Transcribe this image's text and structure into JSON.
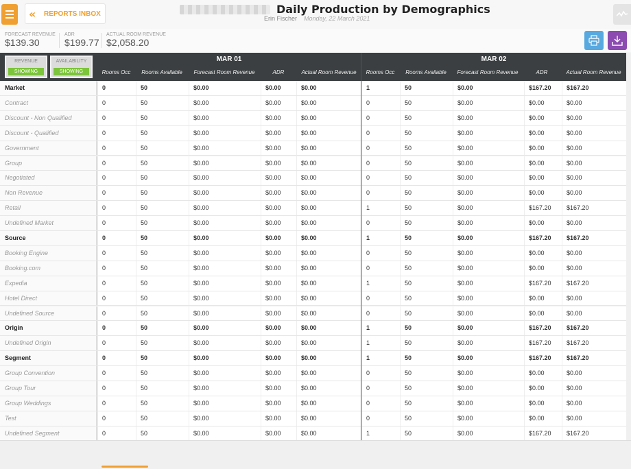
{
  "header": {
    "back_label": "REPORTS INBOX",
    "title": "Daily Production by Demographics",
    "user": "Erin Fischer",
    "date": "Monday, 22 March 2021"
  },
  "stats": [
    {
      "label": "FORECAST REVENUE",
      "value": "$139.30"
    },
    {
      "label": "ADR",
      "value": "$199.77"
    },
    {
      "label": "ACTUAL ROOM REVENUE",
      "value": "$2,058.20"
    }
  ],
  "toggles": [
    {
      "label": "REVENUE",
      "state": "SHOWING"
    },
    {
      "label": "AVAILABILITY",
      "state": "SHOWING"
    }
  ],
  "columns": [
    "Rooms Occ",
    "Rooms Available",
    "Forecast Room Revenue",
    "ADR",
    "Actual Room Revenue"
  ],
  "dates": [
    "MAR 01",
    "MAR 02"
  ],
  "rows": [
    {
      "label": "Market",
      "bold": true,
      "d1": [
        "0",
        "50",
        "$0.00",
        "$0.00",
        "$0.00"
      ],
      "d2": [
        "1",
        "50",
        "$0.00",
        "$167.20",
        "$167.20"
      ]
    },
    {
      "label": "Contract",
      "bold": false,
      "d1": [
        "0",
        "50",
        "$0.00",
        "$0.00",
        "$0.00"
      ],
      "d2": [
        "0",
        "50",
        "$0.00",
        "$0.00",
        "$0.00"
      ]
    },
    {
      "label": "Discount - Non Qualified",
      "bold": false,
      "d1": [
        "0",
        "50",
        "$0.00",
        "$0.00",
        "$0.00"
      ],
      "d2": [
        "0",
        "50",
        "$0.00",
        "$0.00",
        "$0.00"
      ]
    },
    {
      "label": "Discount - Qualified",
      "bold": false,
      "d1": [
        "0",
        "50",
        "$0.00",
        "$0.00",
        "$0.00"
      ],
      "d2": [
        "0",
        "50",
        "$0.00",
        "$0.00",
        "$0.00"
      ]
    },
    {
      "label": "Government",
      "bold": false,
      "d1": [
        "0",
        "50",
        "$0.00",
        "$0.00",
        "$0.00"
      ],
      "d2": [
        "0",
        "50",
        "$0.00",
        "$0.00",
        "$0.00"
      ]
    },
    {
      "label": "Group",
      "bold": false,
      "d1": [
        "0",
        "50",
        "$0.00",
        "$0.00",
        "$0.00"
      ],
      "d2": [
        "0",
        "50",
        "$0.00",
        "$0.00",
        "$0.00"
      ]
    },
    {
      "label": "Negotiated",
      "bold": false,
      "d1": [
        "0",
        "50",
        "$0.00",
        "$0.00",
        "$0.00"
      ],
      "d2": [
        "0",
        "50",
        "$0.00",
        "$0.00",
        "$0.00"
      ]
    },
    {
      "label": "Non Revenue",
      "bold": false,
      "d1": [
        "0",
        "50",
        "$0.00",
        "$0.00",
        "$0.00"
      ],
      "d2": [
        "0",
        "50",
        "$0.00",
        "$0.00",
        "$0.00"
      ]
    },
    {
      "label": "Retail",
      "bold": false,
      "d1": [
        "0",
        "50",
        "$0.00",
        "$0.00",
        "$0.00"
      ],
      "d2": [
        "1",
        "50",
        "$0.00",
        "$167.20",
        "$167.20"
      ]
    },
    {
      "label": "Undefined Market",
      "bold": false,
      "d1": [
        "0",
        "50",
        "$0.00",
        "$0.00",
        "$0.00"
      ],
      "d2": [
        "0",
        "50",
        "$0.00",
        "$0.00",
        "$0.00"
      ]
    },
    {
      "label": "Source",
      "bold": true,
      "d1": [
        "0",
        "50",
        "$0.00",
        "$0.00",
        "$0.00"
      ],
      "d2": [
        "1",
        "50",
        "$0.00",
        "$167.20",
        "$167.20"
      ]
    },
    {
      "label": "Booking Engine",
      "bold": false,
      "d1": [
        "0",
        "50",
        "$0.00",
        "$0.00",
        "$0.00"
      ],
      "d2": [
        "0",
        "50",
        "$0.00",
        "$0.00",
        "$0.00"
      ]
    },
    {
      "label": "Booking.com",
      "bold": false,
      "d1": [
        "0",
        "50",
        "$0.00",
        "$0.00",
        "$0.00"
      ],
      "d2": [
        "0",
        "50",
        "$0.00",
        "$0.00",
        "$0.00"
      ]
    },
    {
      "label": "Expedia",
      "bold": false,
      "d1": [
        "0",
        "50",
        "$0.00",
        "$0.00",
        "$0.00"
      ],
      "d2": [
        "1",
        "50",
        "$0.00",
        "$167.20",
        "$167.20"
      ]
    },
    {
      "label": "Hotel Direct",
      "bold": false,
      "d1": [
        "0",
        "50",
        "$0.00",
        "$0.00",
        "$0.00"
      ],
      "d2": [
        "0",
        "50",
        "$0.00",
        "$0.00",
        "$0.00"
      ]
    },
    {
      "label": "Undefined Source",
      "bold": false,
      "d1": [
        "0",
        "50",
        "$0.00",
        "$0.00",
        "$0.00"
      ],
      "d2": [
        "0",
        "50",
        "$0.00",
        "$0.00",
        "$0.00"
      ]
    },
    {
      "label": "Origin",
      "bold": true,
      "d1": [
        "0",
        "50",
        "$0.00",
        "$0.00",
        "$0.00"
      ],
      "d2": [
        "1",
        "50",
        "$0.00",
        "$167.20",
        "$167.20"
      ]
    },
    {
      "label": "Undefined Origin",
      "bold": false,
      "d1": [
        "0",
        "50",
        "$0.00",
        "$0.00",
        "$0.00"
      ],
      "d2": [
        "1",
        "50",
        "$0.00",
        "$167.20",
        "$167.20"
      ]
    },
    {
      "label": "Segment",
      "bold": true,
      "d1": [
        "0",
        "50",
        "$0.00",
        "$0.00",
        "$0.00"
      ],
      "d2": [
        "1",
        "50",
        "$0.00",
        "$167.20",
        "$167.20"
      ]
    },
    {
      "label": "Group Convention",
      "bold": false,
      "d1": [
        "0",
        "50",
        "$0.00",
        "$0.00",
        "$0.00"
      ],
      "d2": [
        "0",
        "50",
        "$0.00",
        "$0.00",
        "$0.00"
      ]
    },
    {
      "label": "Group Tour",
      "bold": false,
      "d1": [
        "0",
        "50",
        "$0.00",
        "$0.00",
        "$0.00"
      ],
      "d2": [
        "0",
        "50",
        "$0.00",
        "$0.00",
        "$0.00"
      ]
    },
    {
      "label": "Group Weddings",
      "bold": false,
      "d1": [
        "0",
        "50",
        "$0.00",
        "$0.00",
        "$0.00"
      ],
      "d2": [
        "0",
        "50",
        "$0.00",
        "$0.00",
        "$0.00"
      ]
    },
    {
      "label": "Test",
      "bold": false,
      "d1": [
        "0",
        "50",
        "$0.00",
        "$0.00",
        "$0.00"
      ],
      "d2": [
        "0",
        "50",
        "$0.00",
        "$0.00",
        "$0.00"
      ]
    },
    {
      "label": "Undefined Segment",
      "bold": false,
      "d1": [
        "0",
        "50",
        "$0.00",
        "$0.00",
        "$0.00"
      ],
      "d2": [
        "1",
        "50",
        "$0.00",
        "$167.20",
        "$167.20"
      ]
    }
  ],
  "colors": {
    "accent": "#f0a030",
    "header_bg": "#3b3f41",
    "showing": "#7cc43b",
    "print": "#58a9df",
    "download": "#8b4bb0"
  },
  "icons": [
    "menu-icon",
    "double-chevron-left-icon",
    "trend-icon",
    "print-icon",
    "download-icon"
  ]
}
